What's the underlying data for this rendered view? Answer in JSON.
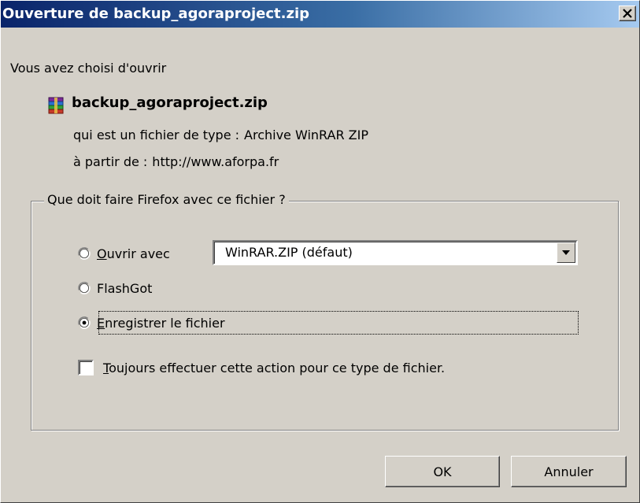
{
  "window": {
    "title": "Ouverture de backup_agoraproject.zip",
    "close_label": "×"
  },
  "intro": {
    "text": "Vous avez choisi d'ouvrir"
  },
  "file": {
    "name": "backup_agoraproject.zip",
    "icon": "winrar-archive-icon",
    "type_label": "qui est un fichier de type :",
    "type_value": "Archive WinRAR ZIP",
    "from_label": "à partir de :",
    "from_value": "http://www.aforpa.fr"
  },
  "group": {
    "legend": "Que doit faire Firefox avec ce fichier ?",
    "options": [
      {
        "label": "Ouvrir avec",
        "selected": false
      },
      {
        "label": "FlashGot",
        "selected": false
      },
      {
        "label": "Enregistrer le fichier",
        "selected": true
      }
    ],
    "open_with_app": "WinRAR.ZIP (défaut)",
    "always_checkbox": {
      "label": "Toujours effectuer cette action pour ce type de fichier.",
      "checked": false
    }
  },
  "buttons": {
    "ok": "OK",
    "cancel": "Annuler"
  },
  "colors": {
    "titlebar_start": "#0a246a",
    "titlebar_end": "#a6caf0",
    "dialog_bg": "#d4d0c8"
  }
}
